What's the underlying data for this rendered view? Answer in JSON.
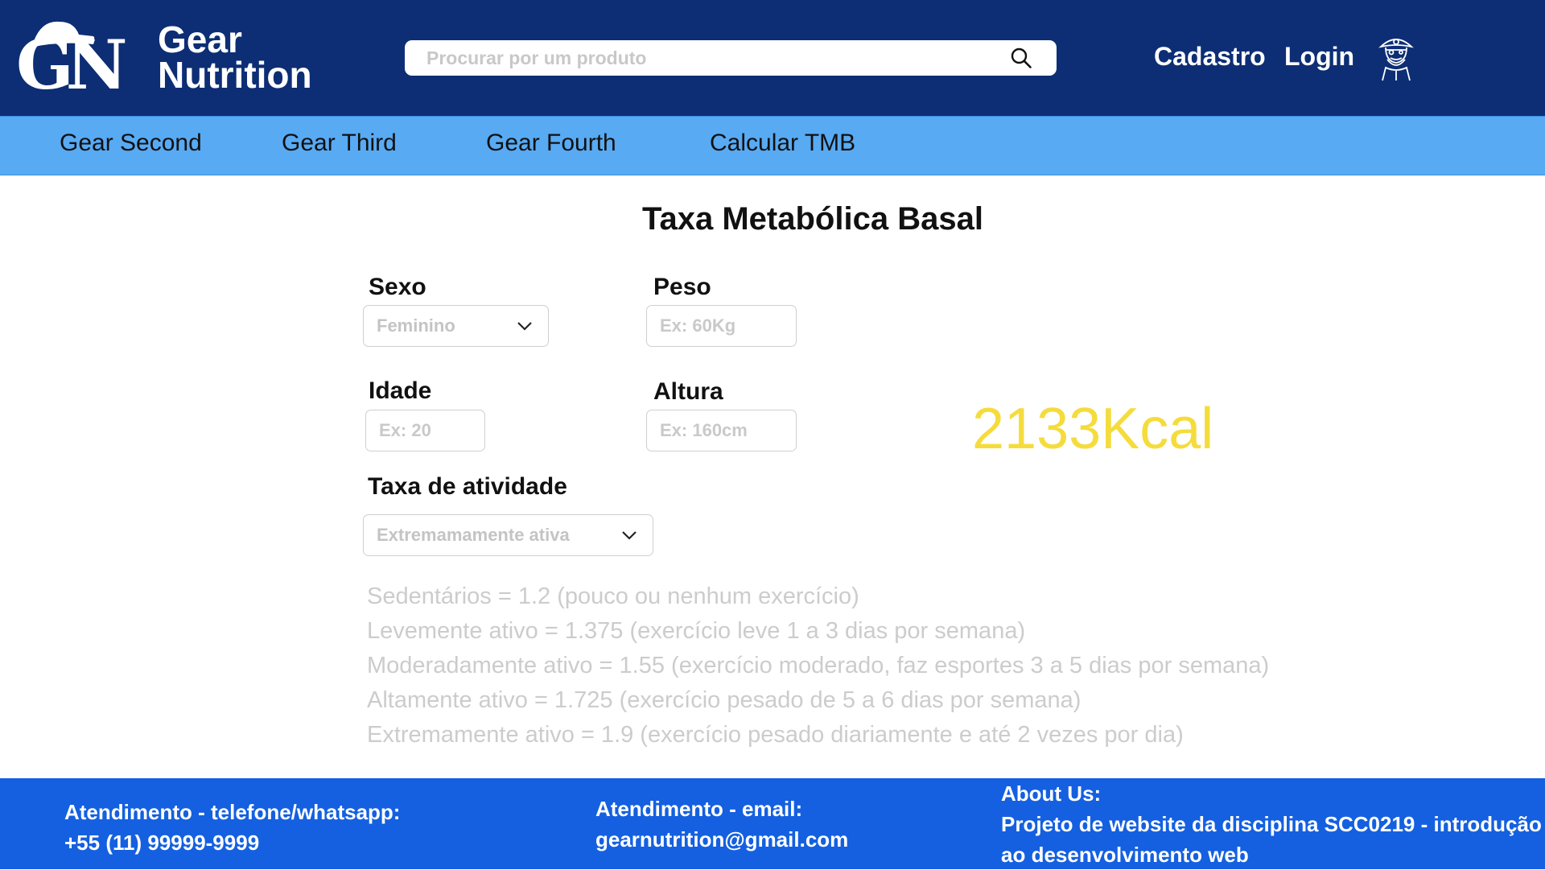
{
  "header": {
    "logo_letters": "GN",
    "logo_line1": "Gear",
    "logo_line2": "Nutrition",
    "search_placeholder": "Procurar por um produto",
    "cadastro": "Cadastro",
    "login": "Login"
  },
  "icons": {
    "search": "search-icon",
    "account": "pirate-avatar-icon",
    "dropdown": "chevron-down-icon"
  },
  "categories": [
    "Gear Second",
    "Gear Third",
    "Gear Fourth",
    "Calcular TMB"
  ],
  "main": {
    "title": "Taxa Metabólica Basal",
    "sexo_label": "Sexo",
    "sexo_value": "Feminino",
    "peso_label": "Peso",
    "peso_placeholder": "Ex: 60Kg",
    "idade_label": "Idade",
    "idade_placeholder": "Ex: 20",
    "altura_label": "Altura",
    "altura_placeholder": "Ex: 160cm",
    "atividade_label": "Taxa de atividade",
    "atividade_value": "Extremamamente ativa",
    "result": "2133Kcal",
    "activity_levels": [
      "Sedentários = 1.2 (pouco ou nenhum exercício)",
      "Levemente ativo = 1.375 (exercício leve 1 a 3 dias por semana)",
      "Moderadamente ativo = 1.55 (exercício moderado, faz esportes 3 a 5 dias por semana)",
      "Altamente ativo = 1.725 (exercício pesado de 5 a 6 dias por semana)",
      "Extremamente ativo = 1.9 (exercício pesado diariamente e até 2 vezes por dia)"
    ]
  },
  "footer": {
    "phone_title": "Atendimento - telefone/whatsapp:",
    "phone": "+55 (11) 99999-9999",
    "email_title": "Atendimento - email:",
    "email": "gearnutrition@gmail.com",
    "about_title": "About Us:",
    "about_line1": "Projeto de website da disciplina SCC0219 - introdução",
    "about_line2": "ao desenvolvimento web"
  },
  "colors": {
    "header_bg": "#0d2e75",
    "category_bar": "#58aaf3",
    "footer_bg": "#1460e0",
    "result_text": "#f5dc3c"
  }
}
